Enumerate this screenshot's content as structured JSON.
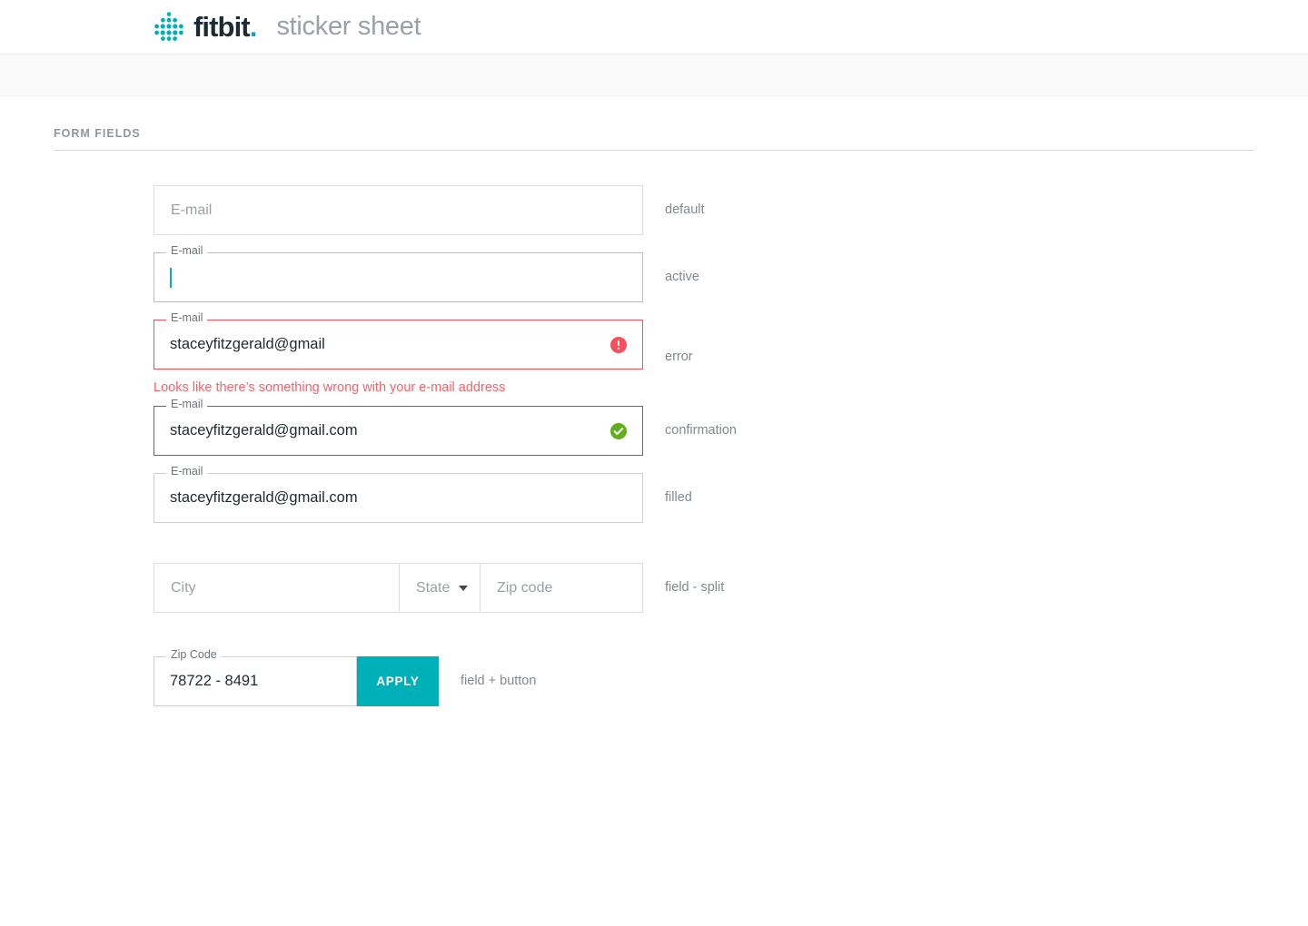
{
  "header": {
    "brand": "fitbit",
    "brand_dot": ".",
    "title": "sticker sheet",
    "logo_icon": "fitbit-dots-logo",
    "brand_color": "#1b2a34",
    "accent_color": "#00b0b9"
  },
  "section": {
    "title": "FORM FIELDS"
  },
  "colors": {
    "accent": "#00b0b9",
    "error": "#f4515b",
    "error_text": "#fc6168",
    "success_border": "#5b7f1e",
    "success_icon": "#61af19",
    "border_default": "#dcdfe1",
    "label_text": "#82898f"
  },
  "fields": {
    "default": {
      "placeholder": "E-mail",
      "annotation": "default"
    },
    "active": {
      "label": "E-mail",
      "value": "",
      "annotation": "active"
    },
    "error": {
      "label": "E-mail",
      "value": "staceyfitzgerald@gmail",
      "icon": "error-exclamation-icon",
      "message": "Looks like there’s something wrong with your e-mail address",
      "annotation": "error"
    },
    "confirmation": {
      "label": "E-mail",
      "value": "staceyfitzgerald@gmail.com",
      "icon": "success-check-icon",
      "annotation": "confirmation"
    },
    "filled": {
      "label": "E-mail",
      "value": "staceyfitzgerald@gmail.com",
      "annotation": "filled"
    },
    "split": {
      "city_placeholder": "City",
      "state_placeholder": "State",
      "state_icon": "chevron-down-icon",
      "zip_placeholder": "Zip code",
      "annotation": "field - split"
    },
    "field_button": {
      "label": "Zip Code",
      "value": "78722 - 8491",
      "button_label": "APPLY",
      "annotation": "field + button"
    }
  }
}
